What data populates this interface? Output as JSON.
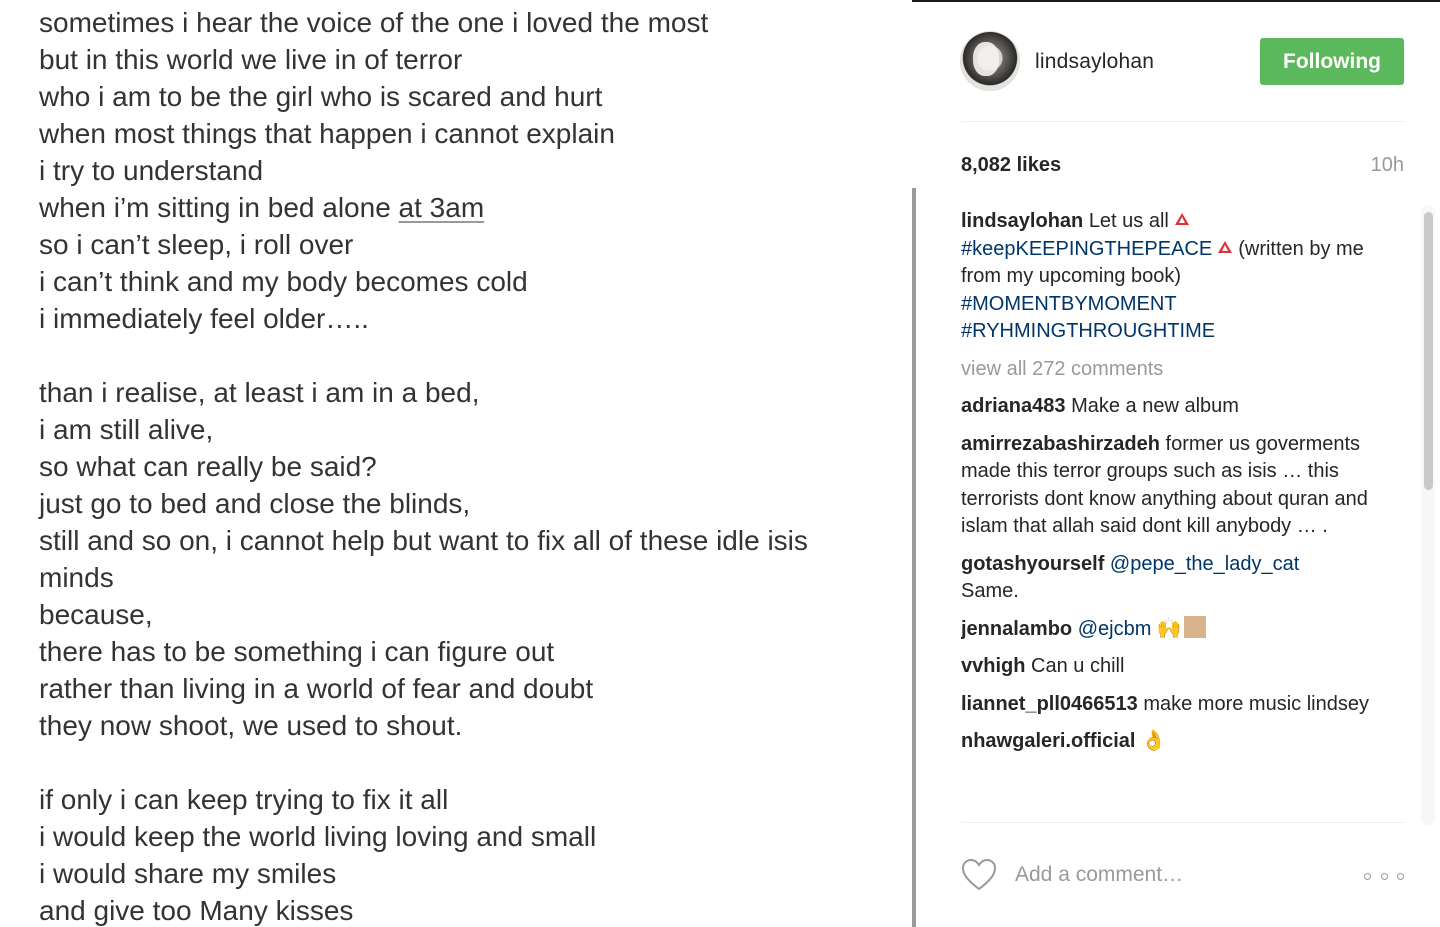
{
  "poem": {
    "stanza1": [
      "sometimes i hear the voice of the one i loved the most",
      "but in this world we live in of terror",
      "who i am to be the girl who is scared and hurt",
      "when most things that happen i cannot explain",
      "i try to understand",
      "when i’m sitting in bed alone ",
      "at 3am",
      "so i can’t sleep, i roll over",
      "i can’t think and my body becomes cold",
      "i immediately feel older….."
    ],
    "stanza2": [
      "than i realise, at least i am in a bed,",
      "i am still alive,",
      "so what can really be said?",
      "just go to bed and close the blinds,",
      "still and so on, i cannot help but want to fix all of these idle isis",
      "minds",
      "because,",
      "there has to be something i can figure out",
      "rather than living in a world of fear and doubt",
      "they now shoot, we used to shout."
    ],
    "stanza3": [
      "if only i can keep trying to fix it all",
      "i would keep the world living loving and small",
      "i would share my smiles",
      "and give too Many kisses"
    ]
  },
  "header": {
    "username": "lindsaylohan",
    "follow_label": "Following"
  },
  "stats": {
    "likes": "8,082 likes",
    "time": "10h"
  },
  "caption": {
    "user": "lindsaylohan",
    "text1": "Let us all",
    "tag1": "#keepKEEPINGTHEPEACE",
    "text2": "(written by me from my upcoming book)",
    "tag2": "#MOMENTBYMOMENT",
    "tag3": "#RYHMINGTHROUGHTIME"
  },
  "view_all": "view all 272 comments",
  "comments": [
    {
      "user": "adriana483",
      "text": "Make a new album"
    },
    {
      "user": "amirrezabashirzadeh",
      "text": "former us goverments made this terror groups such as isis … this terrorists dont know anything about quran and islam that allah said dont kill anybody … ."
    },
    {
      "user": "gotashyourself",
      "mention": "@pepe_the_lady_cat",
      "text": "Same."
    },
    {
      "user": "jennalambo",
      "mention": "@ejcbm",
      "emoji": "🙌"
    },
    {
      "user": "vvhigh",
      "text": "Can u chill"
    },
    {
      "user": "liannet_pll0466513",
      "text": "make more music lindsey"
    },
    {
      "user": "nhawgaleri.official",
      "emoji": "👌"
    }
  ],
  "footer": {
    "add_comment_placeholder": "Add a comment…"
  },
  "colors": {
    "follow_green": "#5cb85c",
    "hashtag_blue": "#003569",
    "muted_gray": "#999999"
  },
  "icons": [
    "heart-icon",
    "more-options-icon",
    "warning-icon",
    "avatar"
  ]
}
